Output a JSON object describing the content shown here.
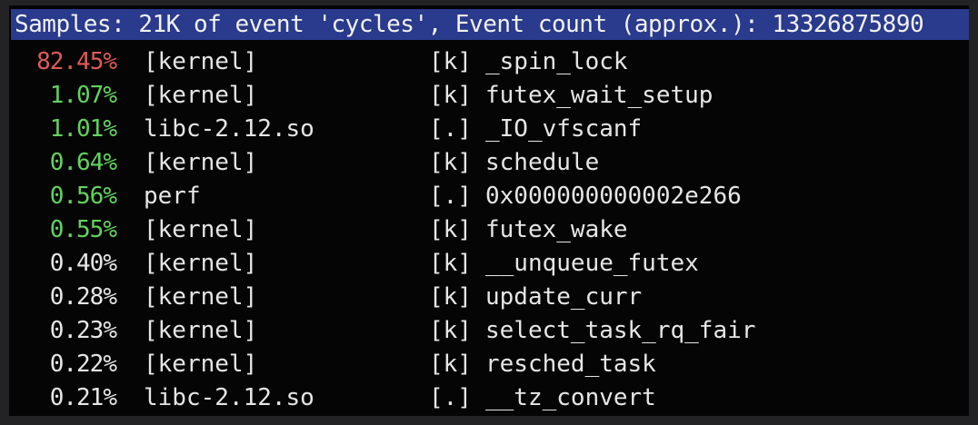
{
  "header": "Samples: 21K of event 'cycles', Event count (approx.): 13326875890",
  "colors": {
    "hot": "#e05a5a",
    "warm": "#62d35e",
    "normal": "#e6e6e6",
    "header_bg": "#2a3a8c"
  },
  "rows": [
    {
      "overhead": "82.45%",
      "dso": "[kernel]",
      "level": "[k]",
      "symbol": "_spin_lock"
    },
    {
      "overhead": "1.07%",
      "dso": "[kernel]",
      "level": "[k]",
      "symbol": "futex_wait_setup"
    },
    {
      "overhead": "1.01%",
      "dso": "libc-2.12.so",
      "level": "[.]",
      "symbol": "_IO_vfscanf"
    },
    {
      "overhead": "0.64%",
      "dso": "[kernel]",
      "level": "[k]",
      "symbol": "schedule"
    },
    {
      "overhead": "0.56%",
      "dso": "perf",
      "level": "[.]",
      "symbol": "0x000000000002e266"
    },
    {
      "overhead": "0.55%",
      "dso": "[kernel]",
      "level": "[k]",
      "symbol": "futex_wake"
    },
    {
      "overhead": "0.40%",
      "dso": "[kernel]",
      "level": "[k]",
      "symbol": "__unqueue_futex"
    },
    {
      "overhead": "0.28%",
      "dso": "[kernel]",
      "level": "[k]",
      "symbol": "update_curr"
    },
    {
      "overhead": "0.23%",
      "dso": "[kernel]",
      "level": "[k]",
      "symbol": "select_task_rq_fair"
    },
    {
      "overhead": "0.22%",
      "dso": "[kernel]",
      "level": "[k]",
      "symbol": "resched_task"
    },
    {
      "overhead": "0.21%",
      "dso": "libc-2.12.so",
      "level": "[.]",
      "symbol": "__tz_convert"
    }
  ]
}
